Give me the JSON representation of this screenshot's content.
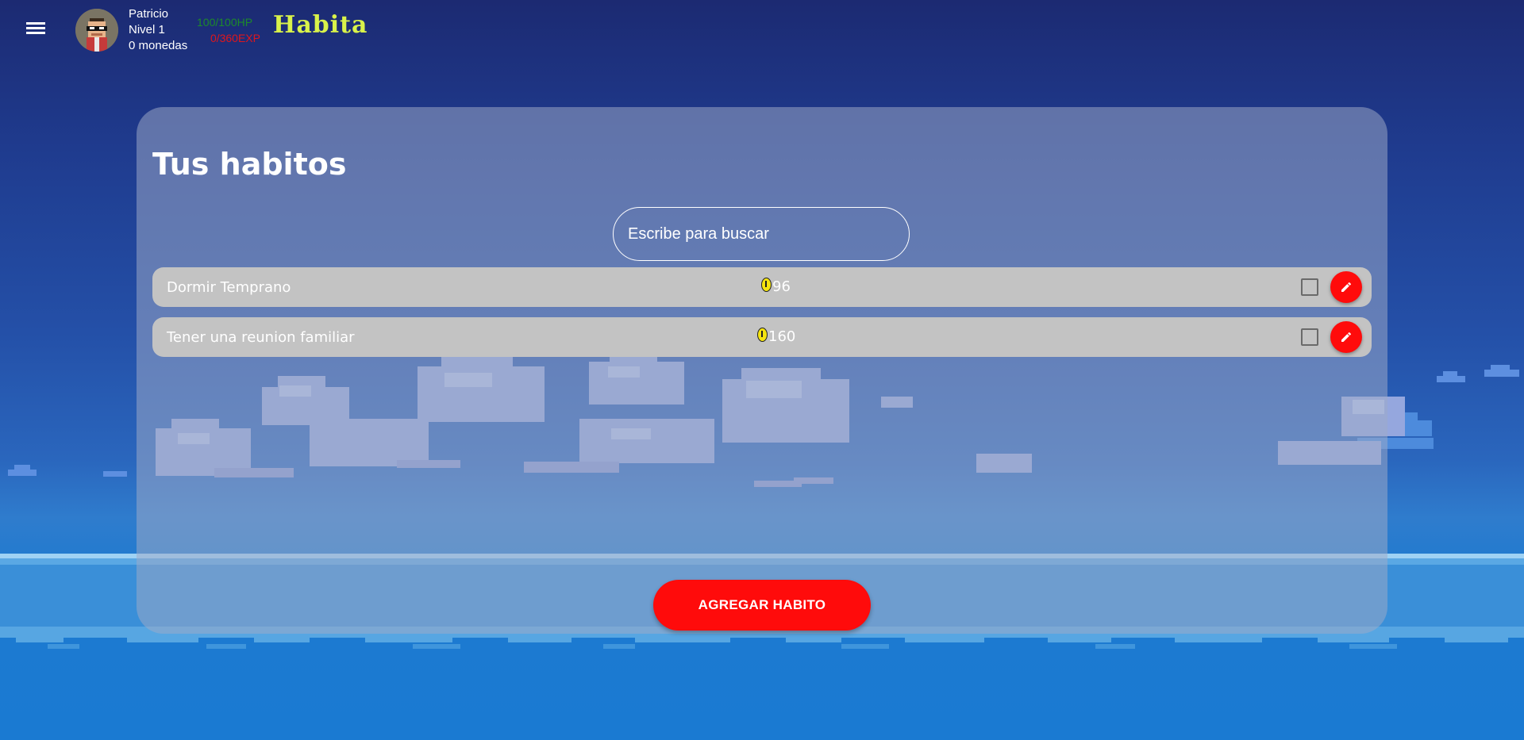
{
  "header": {
    "user_name": "Patricio",
    "level": "Nivel 1",
    "coins": "0 monedas",
    "hp": "100/100HP",
    "exp": "0/360EXP",
    "brand": "Habita",
    "menu_icon": "hamburger-menu-icon",
    "avatar_icon": "pixel-avatar-icon"
  },
  "panel": {
    "title": "Tus habitos",
    "search_placeholder": "Escribe para buscar",
    "habits": [
      {
        "name": "Dormir Temprano",
        "reward": "96"
      },
      {
        "name": "Tener una reunion familiar",
        "reward": "160"
      }
    ],
    "add_button_label": "AGREGAR HABITO"
  },
  "colors": {
    "accent": "#ff0b0b",
    "brand": "#d9f24a",
    "hp": "#1c8a2a",
    "exp": "#e0161b",
    "row_bg": "#c3c3c3"
  }
}
